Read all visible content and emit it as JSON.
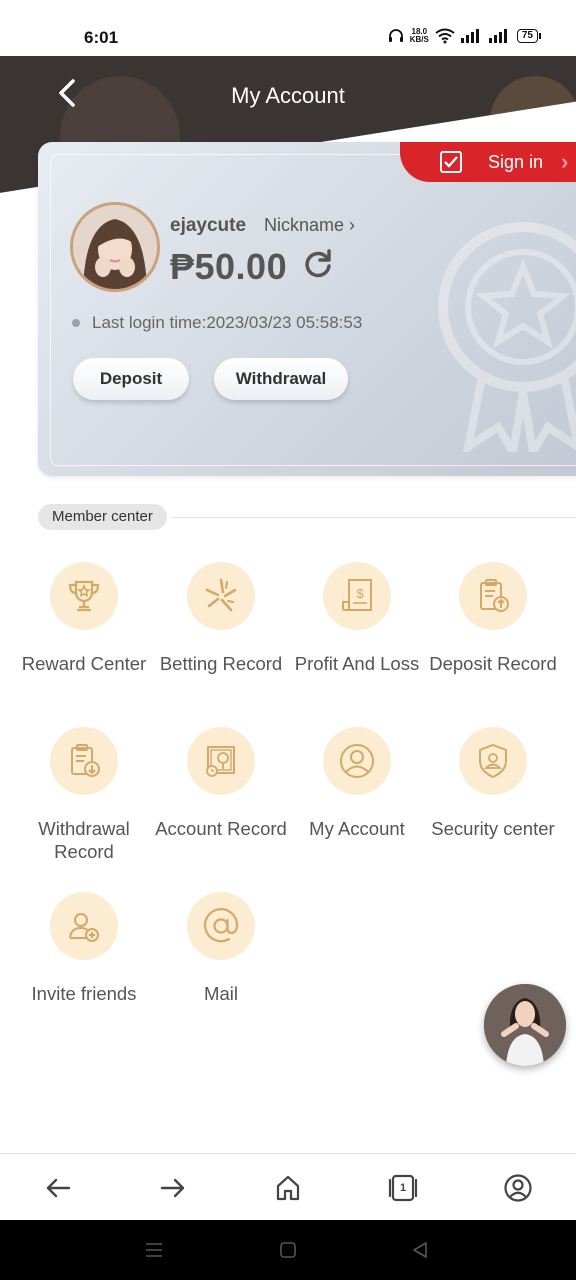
{
  "status": {
    "time": "6:01",
    "net_speed_value": "18.0",
    "net_speed_unit": "KB/S",
    "battery": "75"
  },
  "header": {
    "title": "My Account"
  },
  "account": {
    "sign_in_label": "Sign in",
    "username": "ejaycute",
    "nickname_label": "Nickname ›",
    "balance": "₱50.00",
    "last_login": "Last login time:2023/03/23 05:58:53",
    "deposit_label": "Deposit",
    "withdrawal_label": "Withdrawal"
  },
  "member_center": {
    "title": "Member center",
    "items": [
      {
        "label": "Reward Center",
        "icon": "trophy-icon"
      },
      {
        "label": "Betting Record",
        "icon": "star-burst-icon"
      },
      {
        "label": "Profit And Loss",
        "icon": "dollar-document-icon"
      },
      {
        "label": "Deposit Record",
        "icon": "clipboard-upload-icon"
      },
      {
        "label": "Withdrawal Record",
        "icon": "clipboard-download-icon"
      },
      {
        "label": "Account Record",
        "icon": "account-record-icon"
      },
      {
        "label": "My Account",
        "icon": "user-circle-icon"
      },
      {
        "label": "Security center",
        "icon": "shield-user-icon"
      },
      {
        "label": "Invite friends",
        "icon": "user-add-icon"
      },
      {
        "label": "Mail",
        "icon": "at-sign-icon"
      }
    ]
  },
  "browser_nav": {
    "tab_count": "1"
  },
  "colors": {
    "header_bg": "#3a3433",
    "sign_in_red": "#d9252a",
    "icon_bg": "#fbecd2",
    "icon_stroke": "#d4a867"
  }
}
